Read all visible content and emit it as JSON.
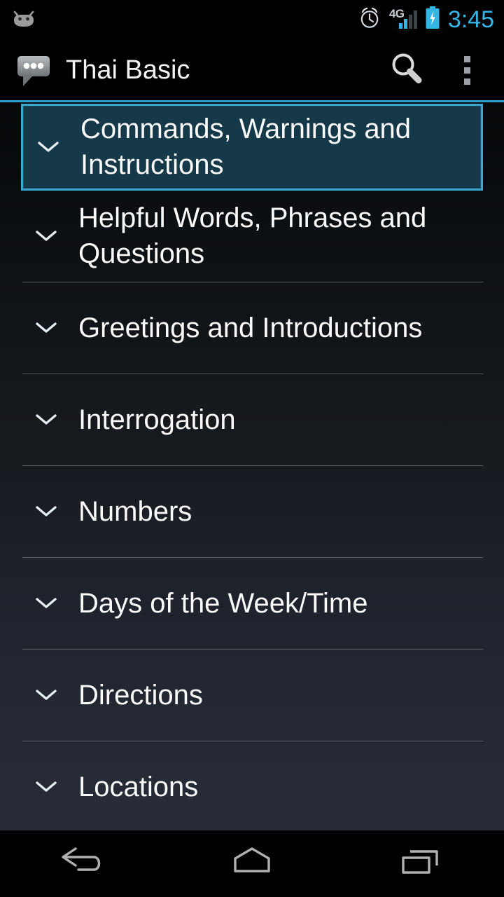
{
  "status_bar": {
    "notification_icon": "android-droid-icon",
    "alarm_icon": "alarm-clock-icon",
    "network_type": "4G",
    "signal_icon": "signal-bars-icon",
    "signal_bars_filled": 2,
    "signal_bars_total": 4,
    "battery_icon": "battery-charging-icon",
    "time": "3:45",
    "accent_color": "#33b5e5"
  },
  "action_bar": {
    "app_icon": "speech-bubble-icon",
    "title": "Thai Basic",
    "search_icon": "search-icon",
    "overflow_icon": "overflow-menu-icon",
    "accent_color": "#2aa3cc"
  },
  "list": {
    "selected_index": 0,
    "selected_fill": "#16394a",
    "selected_border": "#3aa8cf",
    "expand_icon": "chevron-down-icon",
    "items": [
      {
        "label": "Commands, Warnings and Instructions",
        "selected": true
      },
      {
        "label": "Helpful Words, Phrases and Questions",
        "selected": false
      },
      {
        "label": "Greetings and Introductions",
        "selected": false
      },
      {
        "label": "Interrogation",
        "selected": false
      },
      {
        "label": "Numbers",
        "selected": false
      },
      {
        "label": "Days of the Week/Time",
        "selected": false
      },
      {
        "label": "Directions",
        "selected": false
      },
      {
        "label": "Locations",
        "selected": false
      }
    ]
  },
  "nav_bar": {
    "back_icon": "back-arrow-icon",
    "home_icon": "home-icon",
    "recents_icon": "recent-apps-icon"
  }
}
